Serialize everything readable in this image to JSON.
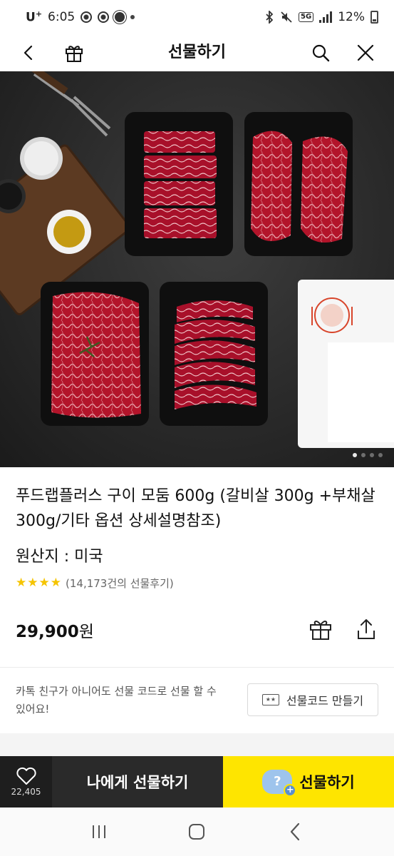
{
  "status_bar": {
    "carrier": "U",
    "carrier_sup": "+",
    "time": "6:05",
    "network": "5G",
    "battery": "12%"
  },
  "header": {
    "title": "선물하기"
  },
  "product": {
    "title": "푸드랩플러스 구이 모둠 600g (갈비살 300g +부채살 300g/기타 옵션 상세설명참조)",
    "origin": "원산지 : 미국",
    "rating_stars": 4,
    "review_text": "(14,173건의 선물후기)",
    "price": "29,900",
    "price_unit": "원",
    "image_page_index": 1,
    "image_page_count": 4
  },
  "gift_code": {
    "description": "카톡 친구가 아니어도 선물 코드로 선물 할 수 있어요!",
    "button_label": "선물코드 만들기"
  },
  "action_bar": {
    "like_count": "22,405",
    "self_gift_label": "나에게 선물하기",
    "gift_label": "선물하기",
    "gift_accent": "#fee500"
  },
  "icons": [
    "back-icon",
    "gift-icon",
    "search-icon",
    "close-icon",
    "gift-box-icon",
    "share-icon",
    "heart-icon",
    "recents-icon",
    "home-icon",
    "nav-back-icon"
  ]
}
